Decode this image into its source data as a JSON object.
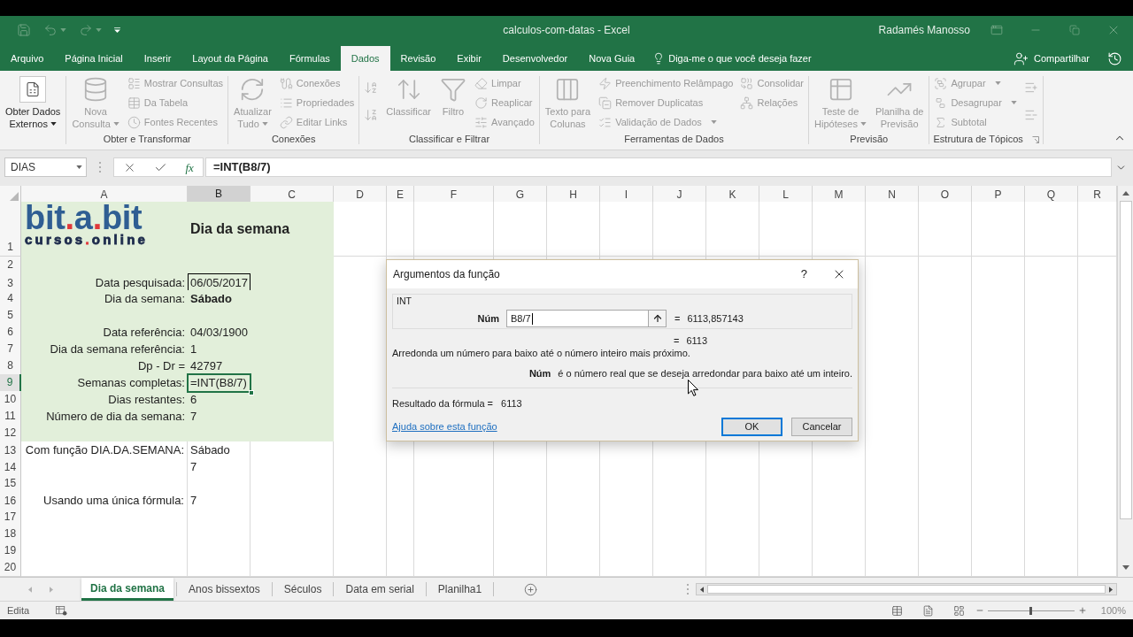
{
  "title_bar": {
    "document": "calculos-com-datas - Excel",
    "user": "Radamés Manosso"
  },
  "ribbon_tabs": [
    {
      "label": "Arquivo",
      "selected": false
    },
    {
      "label": "Página Inicial",
      "selected": false
    },
    {
      "label": "Inserir",
      "selected": false
    },
    {
      "label": "Layout da Página",
      "selected": false
    },
    {
      "label": "Fórmulas",
      "selected": false
    },
    {
      "label": "Dados",
      "selected": true
    },
    {
      "label": "Revisão",
      "selected": false
    },
    {
      "label": "Exibir",
      "selected": false
    },
    {
      "label": "Desenvolvedor",
      "selected": false
    },
    {
      "label": "Nova Guia",
      "selected": false
    }
  ],
  "tell_me": {
    "placeholder": "Diga-me o que você deseja fazer"
  },
  "share_button": "Compartilhar",
  "ribbon_groups": [
    {
      "columns": [
        {
          "kind": "large",
          "lines": [
            "Obter Dados",
            "Externos"
          ],
          "dropdown": true,
          "disabled": false
        }
      ]
    },
    {
      "label": "Obter e Transformar",
      "columns": [
        {
          "kind": "large",
          "lines": [
            "Nova",
            "Consulta"
          ],
          "dropdown": true,
          "disabled": true
        },
        {
          "kind": "small",
          "items": [
            {
              "label": "Mostrar Consultas",
              "disabled": true
            },
            {
              "label": "Da Tabela",
              "disabled": true
            },
            {
              "label": "Fontes Recentes",
              "disabled": true
            }
          ]
        }
      ]
    },
    {
      "label": "Conexões",
      "columns": [
        {
          "kind": "large",
          "lines": [
            "Atualizar",
            "Tudo"
          ],
          "dropdown": true,
          "disabled": true
        },
        {
          "kind": "small",
          "items": [
            {
              "label": "Conexões",
              "disabled": true
            },
            {
              "label": "Propriedades",
              "disabled": true
            },
            {
              "label": "Editar Links",
              "disabled": true
            }
          ]
        }
      ]
    },
    {
      "label": "Classificar e Filtrar",
      "columns": [
        {
          "kind": "icons",
          "items": [
            {
              "disabled": true
            },
            {
              "disabled": true
            }
          ]
        },
        {
          "kind": "large",
          "lines": [
            "Classificar"
          ],
          "disabled": true
        },
        {
          "kind": "large",
          "lines": [
            "Filtro"
          ],
          "disabled": true
        },
        {
          "kind": "small",
          "items": [
            {
              "label": "Limpar",
              "disabled": true
            },
            {
              "label": "Reaplicar",
              "disabled": true
            },
            {
              "label": "Avançado",
              "disabled": true
            }
          ]
        }
      ]
    },
    {
      "label": "Ferramentas de Dados",
      "columns": [
        {
          "kind": "large",
          "lines": [
            "Texto para",
            "Colunas"
          ],
          "disabled": true
        },
        {
          "kind": "small",
          "items": [
            {
              "label": "Preenchimento Relâmpago",
              "disabled": true
            },
            {
              "label": "Remover Duplicatas",
              "disabled": true
            },
            {
              "label": "Validação de Dados",
              "dropdown": true,
              "disabled": true
            }
          ]
        },
        {
          "kind": "small",
          "items": [
            {
              "label": "Consolidar",
              "disabled": true
            },
            {
              "label": "Relações",
              "disabled": true
            }
          ]
        }
      ]
    },
    {
      "label": "Previsão",
      "columns": [
        {
          "kind": "large",
          "lines": [
            "Teste de",
            "Hipóteses"
          ],
          "dropdown": true,
          "disabled": true
        },
        {
          "kind": "large",
          "lines": [
            "Planilha de",
            "Previsão"
          ],
          "disabled": true
        }
      ]
    },
    {
      "label": "Estrutura de Tópicos",
      "launcher": true,
      "columns": [
        {
          "kind": "small",
          "items": [
            {
              "label": "Agrupar",
              "dropdown": true,
              "disabled": true
            },
            {
              "label": "Desagrupar",
              "dropdown": true,
              "disabled": true
            },
            {
              "label": "Subtotal",
              "disabled": true
            }
          ]
        },
        {
          "kind": "icons",
          "items": [
            {
              "disabled": true
            },
            {
              "disabled": true
            }
          ]
        }
      ]
    }
  ],
  "formula_bar": {
    "name_box": "DIAS",
    "function_button": "fx",
    "formula": "=INT(B8/7)"
  },
  "sheet": {
    "columns": [
      {
        "label": "A",
        "selected": false
      },
      {
        "label": "B",
        "selected": true
      },
      {
        "label": "C",
        "selected": false
      },
      {
        "label": "D",
        "selected": false
      },
      {
        "label": "E",
        "selected": false
      },
      {
        "label": "F",
        "selected": false
      },
      {
        "label": "G",
        "selected": false
      },
      {
        "label": "H",
        "selected": false
      },
      {
        "label": "I",
        "selected": false
      },
      {
        "label": "J",
        "selected": false
      },
      {
        "label": "K",
        "selected": false
      },
      {
        "label": "L",
        "selected": false
      },
      {
        "label": "M",
        "selected": false
      },
      {
        "label": "N",
        "selected": false
      },
      {
        "label": "O",
        "selected": false
      },
      {
        "label": "P",
        "selected": false
      },
      {
        "label": "Q",
        "selected": false
      },
      {
        "label": "R",
        "selected": false
      }
    ],
    "rows": [
      {
        "number": "1",
        "selected": false,
        "shaded": true,
        "logo": {
          "lines": [
            [
              {
                "text": "bit",
                "color": "#2f5e93"
              },
              {
                "text": ".",
                "color": "#e0383a"
              },
              {
                "text": "a",
                "color": "#2f5e93"
              },
              {
                "text": ".",
                "color": "#e0383a"
              },
              {
                "text": "bit",
                "color": "#2f5e93"
              }
            ],
            [
              {
                "text": "cursos",
                "color": "#1d2b4c"
              },
              {
                "text": ".",
                "color": "#e0383a"
              },
              {
                "text": "online",
                "color": "#1d2b4c"
              }
            ]
          ]
        },
        "value_cell": {
          "text": "Dia da semana",
          "kind": "heading",
          "selected": false
        }
      },
      {
        "number": "2",
        "selected": false,
        "shaded": true
      },
      {
        "number": "3",
        "selected": false,
        "shaded": true,
        "label_cell": "Data pesquisada:",
        "value_cell": {
          "text": "06/05/2017",
          "kind": "boxed",
          "selected": false
        }
      },
      {
        "number": "4",
        "selected": false,
        "shaded": true,
        "label_cell": "Dia da semana:",
        "value_cell": {
          "text": "Sábado",
          "kind": "bold",
          "selected": false
        }
      },
      {
        "number": "5",
        "selected": false,
        "shaded": true
      },
      {
        "number": "6",
        "selected": false,
        "shaded": true,
        "label_cell": "Data referência:",
        "value_cell": {
          "text": "04/03/1900",
          "kind": "plain",
          "selected": false
        }
      },
      {
        "number": "7",
        "selected": false,
        "shaded": true,
        "label_cell": "Dia da semana referência:",
        "value_cell": {
          "text": "1",
          "kind": "plain",
          "selected": false
        }
      },
      {
        "number": "8",
        "selected": false,
        "shaded": true,
        "label_cell": "Dp - Dr =",
        "value_cell": {
          "text": "42797",
          "kind": "plain",
          "selected": false
        }
      },
      {
        "number": "9",
        "selected": true,
        "shaded": true,
        "label_cell": "Semanas completas:",
        "value_cell": {
          "text": "=INT(B8/7)",
          "kind": "plain",
          "selected": true
        }
      },
      {
        "number": "10",
        "selected": false,
        "shaded": true,
        "label_cell": "Dias restantes:",
        "value_cell": {
          "text": "6",
          "kind": "plain",
          "selected": false
        }
      },
      {
        "number": "11",
        "selected": false,
        "shaded": true,
        "label_cell": "Número de dia da semana:",
        "value_cell": {
          "text": "7",
          "kind": "plain",
          "selected": false
        }
      },
      {
        "number": "12",
        "selected": false,
        "shaded": true
      },
      {
        "number": "13",
        "selected": false,
        "shaded": false,
        "label_cell": "Com função DIA.DA.SEMANA:",
        "value_cell": {
          "text": "Sábado",
          "kind": "plain",
          "selected": false
        }
      },
      {
        "number": "14",
        "selected": false,
        "shaded": false,
        "value_cell": {
          "text": "7",
          "kind": "plain",
          "selected": false
        }
      },
      {
        "number": "15",
        "selected": false,
        "shaded": false
      },
      {
        "number": "16",
        "selected": false,
        "shaded": false,
        "label_cell": "Usando uma única fórmula:",
        "value_cell": {
          "text": "7",
          "kind": "plain",
          "selected": false
        }
      },
      {
        "number": "17",
        "selected": false,
        "shaded": false
      },
      {
        "number": "18",
        "selected": false,
        "shaded": false
      },
      {
        "number": "19",
        "selected": false,
        "shaded": false
      },
      {
        "number": "20",
        "selected": false,
        "shaded": false
      }
    ]
  },
  "dialog": {
    "title": "Argumentos da função",
    "help": "?",
    "function_name": "INT",
    "argument": {
      "label": "Núm",
      "value": "B8/7",
      "equals": "=",
      "result": "6113,857143"
    },
    "function_result": {
      "equals": "=",
      "value": "6113"
    },
    "description": "Arredonda um número para baixo até o número inteiro mais próximo.",
    "argument_help": {
      "label": "Núm",
      "text": "é o número real que se deseja arredondar para baixo até um inteiro."
    },
    "formula_result": {
      "label": "Resultado da fórmula =",
      "value": "6113"
    },
    "help_link": "Ajuda sobre esta função",
    "buttons": [
      {
        "label": "OK",
        "default": true
      },
      {
        "label": "Cancelar",
        "default": false
      }
    ]
  },
  "sheet_tabs": [
    {
      "label": "Dia da semana",
      "selected": true
    },
    {
      "label": "Anos bissextos",
      "selected": false
    },
    {
      "label": "Séculos",
      "selected": false
    },
    {
      "label": "Data em serial",
      "selected": false
    },
    {
      "label": "Planilha1",
      "selected": false
    }
  ],
  "status_bar": {
    "mode": "Edita",
    "zoom": {
      "label": "100%",
      "level": 0.5
    }
  }
}
